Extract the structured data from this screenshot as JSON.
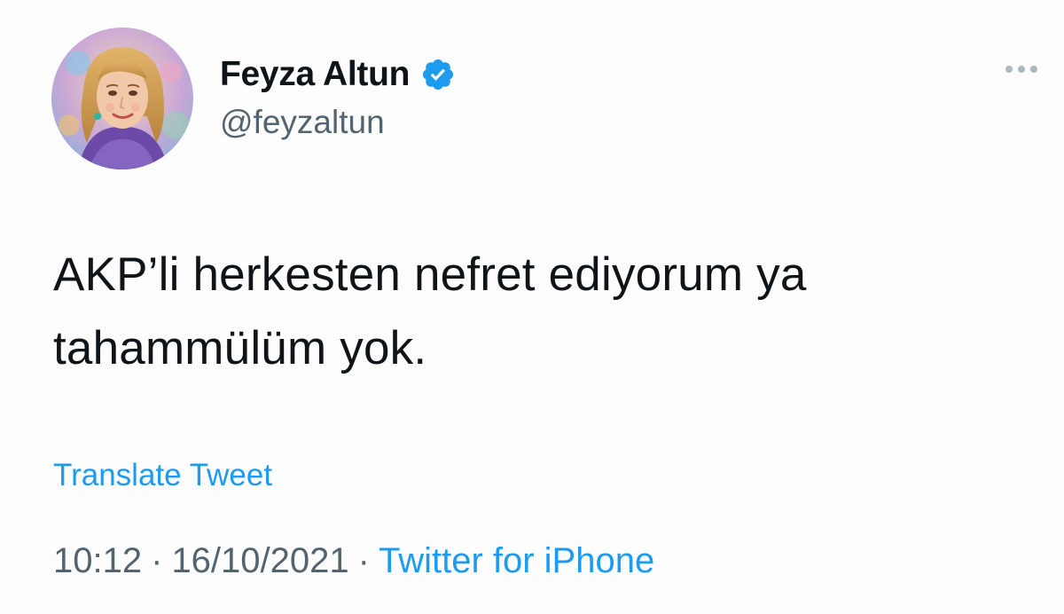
{
  "tweet": {
    "author": {
      "display_name": "Feyza Altun",
      "handle": "@feyzaltun",
      "verified": true,
      "avatar_icon": "profile-photo"
    },
    "more_icon": "more-options-icon",
    "text_line1": "AKP’li herkesten nefret ediyorum ya",
    "text_line2": "tahammülüm yok.",
    "translate_label": "Translate Tweet",
    "time": "10:12",
    "date": "16/10/2021",
    "separator": "·",
    "source": "Twitter for iPhone"
  },
  "colors": {
    "link": "#1d9bf0",
    "secondary_text": "#536471",
    "primary_text": "#0f1419",
    "verified_badge": "#1d9bf0"
  }
}
